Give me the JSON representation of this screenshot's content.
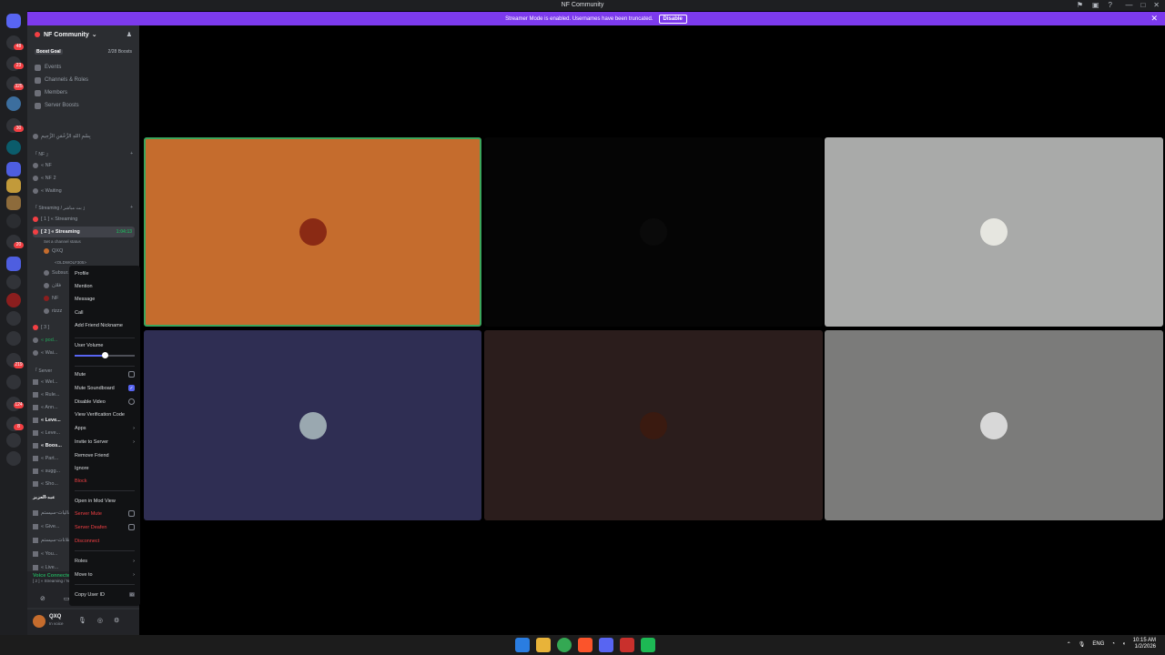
{
  "window": {
    "title": "NF Community"
  },
  "banner": {
    "text": "Streamer Mode is enabled. Usernames have been truncated.",
    "button": "Disable"
  },
  "rail_badges": [
    "48",
    "23",
    "325",
    "30",
    "20",
    "219",
    "124",
    "8"
  ],
  "server": {
    "name": "NF Community",
    "boost_goal": "Boost Goal",
    "boost_count": "2/28 Boosts",
    "nav": [
      "Events",
      "Channels & Roles",
      "Members",
      "Server Boosts"
    ],
    "arabic_header": "بِسْمِ اللهِ الرَّحْمَنِ الرَّحِيمِ"
  },
  "channels": {
    "cat1": "「 NF 」",
    "ch1": "« NF",
    "ch2": "« NF 2",
    "ch3": "« Waiting",
    "cat2": "「 Streaming / بث مباشر 」",
    "ch4": "[ 1 ] « Streaming",
    "ch5": "[ 2 ] « Streaming",
    "ch5_time": "1:04:13",
    "ch5_status": "Set a channel status",
    "user1": "QXQ",
    "user1_sub": "<OLDWOLF305>",
    "user2": "Subsur...",
    "user3": "فلان",
    "user4": "NF",
    "user5": "rizzz",
    "ch6": "[ 3 ]",
    "ch7": "« pod...",
    "ch8": "« Wai...",
    "cat3": "「 Server",
    "t1": "« Wel...",
    "t2": "« Rule...",
    "t3": "« Ann...",
    "t4": "« Leve...",
    "t5": "« Leve...",
    "t6": "« Boos...",
    "t7": "« Part...",
    "t8": "« sugg...",
    "t9": "« Sho...",
    "cat4": "عيد-العزيز",
    "t10": "فعاليات-سيستم",
    "t11": "« Give...",
    "t12": "الاعلانات-سيستم",
    "t13": "« You...",
    "t14": "« Live..."
  },
  "voice": {
    "status": "Voice Connected",
    "channel": "[ 2 ] « Streaming / N..."
  },
  "user_panel": {
    "name": "QXQ",
    "status": "In voice"
  },
  "context_menu": {
    "profile": "Profile",
    "mention": "Mention",
    "message": "Message",
    "call": "Call",
    "add_nickname": "Add Friend Nickname",
    "user_volume": "User Volume",
    "volume_level": 0.5,
    "mute": "Mute",
    "mute_soundboard": "Mute Soundboard",
    "disable_video": "Disable Video",
    "verification": "View Verification Code",
    "apps": "Apps",
    "invite": "Invite to Server",
    "remove_friend": "Remove Friend",
    "ignore": "Ignore",
    "block": "Block",
    "mod_view": "Open in Mod View",
    "server_mute": "Server Mute",
    "server_deafen": "Server Deafen",
    "disconnect": "Disconnect",
    "roles": "Roles",
    "move_to": "Move to",
    "copy_id": "Copy User ID"
  },
  "tiles": {
    "colors": [
      "#c56c2d",
      "#050505",
      "#a9aaa9",
      "#2f2e53",
      "#2b1d1c",
      "#7b7b7a"
    ],
    "speaking_border": "#3ba55c"
  },
  "taskbar": {
    "lang": "ENG",
    "time": "10:15 AM",
    "date": "1/2/2026"
  }
}
